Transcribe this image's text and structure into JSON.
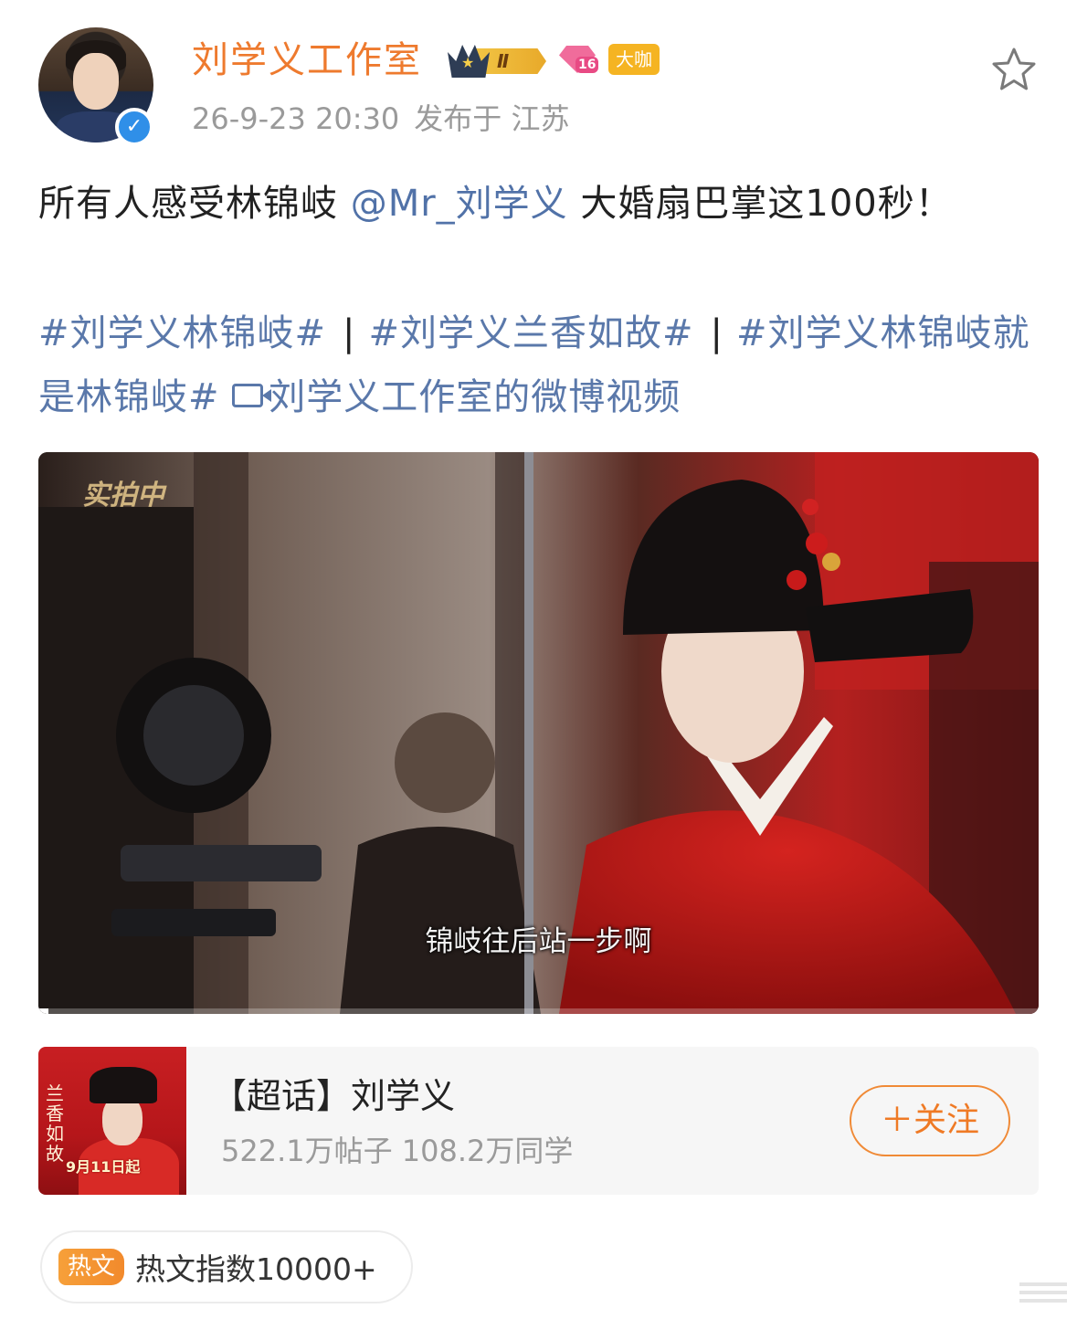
{
  "header": {
    "username": "刘学义工作室",
    "level_badge": "Ⅱ",
    "fan_badge_number": "16",
    "role_badge": "大咖",
    "timestamp": "26-9-23 20:30",
    "location": "发布于 江苏"
  },
  "post": {
    "text_before": "所有人感受林锦岐",
    "mention": "@Mr_刘学义",
    "text_after": " 大婚扇巴掌这100秒！",
    "topic_1": "#刘学义林锦岐#",
    "separator": "|",
    "topic_2": "#刘学义兰香如故#",
    "topic_3": "#刘学义林锦岐就是林锦岐#",
    "video_link": "刘学义工作室的微博视频"
  },
  "video": {
    "watermark": "实拍中",
    "caption": "锦岐往后站一步啊",
    "progress_fraction": 0.01
  },
  "topic_card": {
    "title": "【超话】刘学义",
    "stats": "522.1万帖子 108.2万同学",
    "follow_label": "＋关注",
    "poster_title": "兰香如故",
    "poster_date": "9月11日起"
  },
  "hot_index": {
    "tag": "热文",
    "text": "热文指数10000+"
  },
  "colors": {
    "username": "#ee7a2e",
    "link": "#5a78aa",
    "follow": "#ef7a25",
    "verified": "#2f8fe8"
  },
  "icons": {
    "favorite": "star-outline-icon",
    "verified": "verified-v-icon",
    "video_link": "video-camera-icon"
  }
}
